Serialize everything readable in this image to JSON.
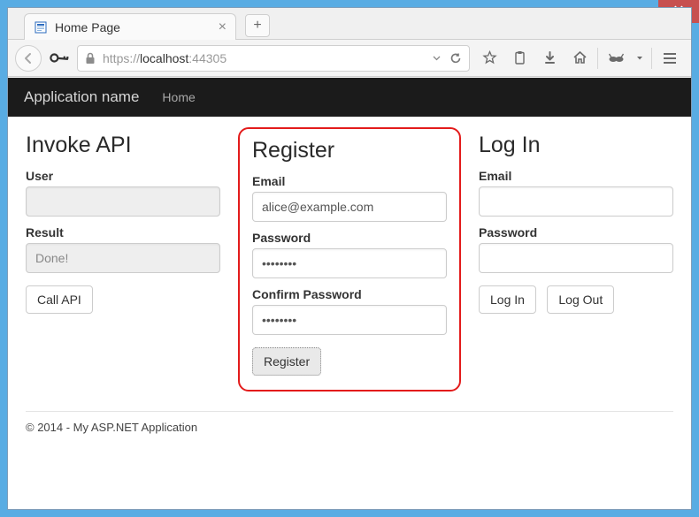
{
  "window": {
    "min": "–",
    "max": "□",
    "close": "✕"
  },
  "browser": {
    "tab_title": "Home Page",
    "url_scheme": "https://",
    "url_host": "localhost",
    "url_port": ":44305"
  },
  "nav": {
    "brand": "Application name",
    "home": "Home"
  },
  "invoke": {
    "heading": "Invoke API",
    "user_label": "User",
    "user_value": "",
    "result_label": "Result",
    "result_value": "Done!",
    "call_button": "Call API"
  },
  "register": {
    "heading": "Register",
    "email_label": "Email",
    "email_value": "alice@example.com",
    "password_label": "Password",
    "password_value": "••••••••",
    "confirm_label": "Confirm Password",
    "confirm_value": "••••••••",
    "register_button": "Register"
  },
  "login": {
    "heading": "Log In",
    "email_label": "Email",
    "email_value": "",
    "password_label": "Password",
    "password_value": "",
    "login_button": "Log In",
    "logout_button": "Log Out"
  },
  "footer": {
    "text": "© 2014 - My ASP.NET Application"
  }
}
